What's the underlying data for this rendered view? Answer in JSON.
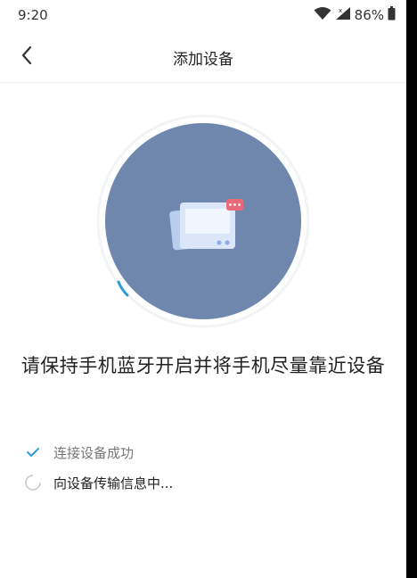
{
  "status_bar": {
    "time": "9:20",
    "battery": "86%",
    "icons": [
      "wifi-icon",
      "signal-icon",
      "battery-icon"
    ]
  },
  "header": {
    "title": "添加设备",
    "back_icon": "chevron-left-icon"
  },
  "visual": {
    "circle_color": "#6f87ad",
    "accent_color": "#2e9bd6",
    "device_icon": "scale-device-icon"
  },
  "instruction": "请保持手机蓝牙开启并将手机尽量靠近设备",
  "steps": [
    {
      "label": "连接设备成功",
      "status": "done",
      "icon": "check-icon"
    },
    {
      "label": "向设备传输信息中...",
      "status": "in-progress",
      "icon": "loading-spinner-icon"
    }
  ]
}
